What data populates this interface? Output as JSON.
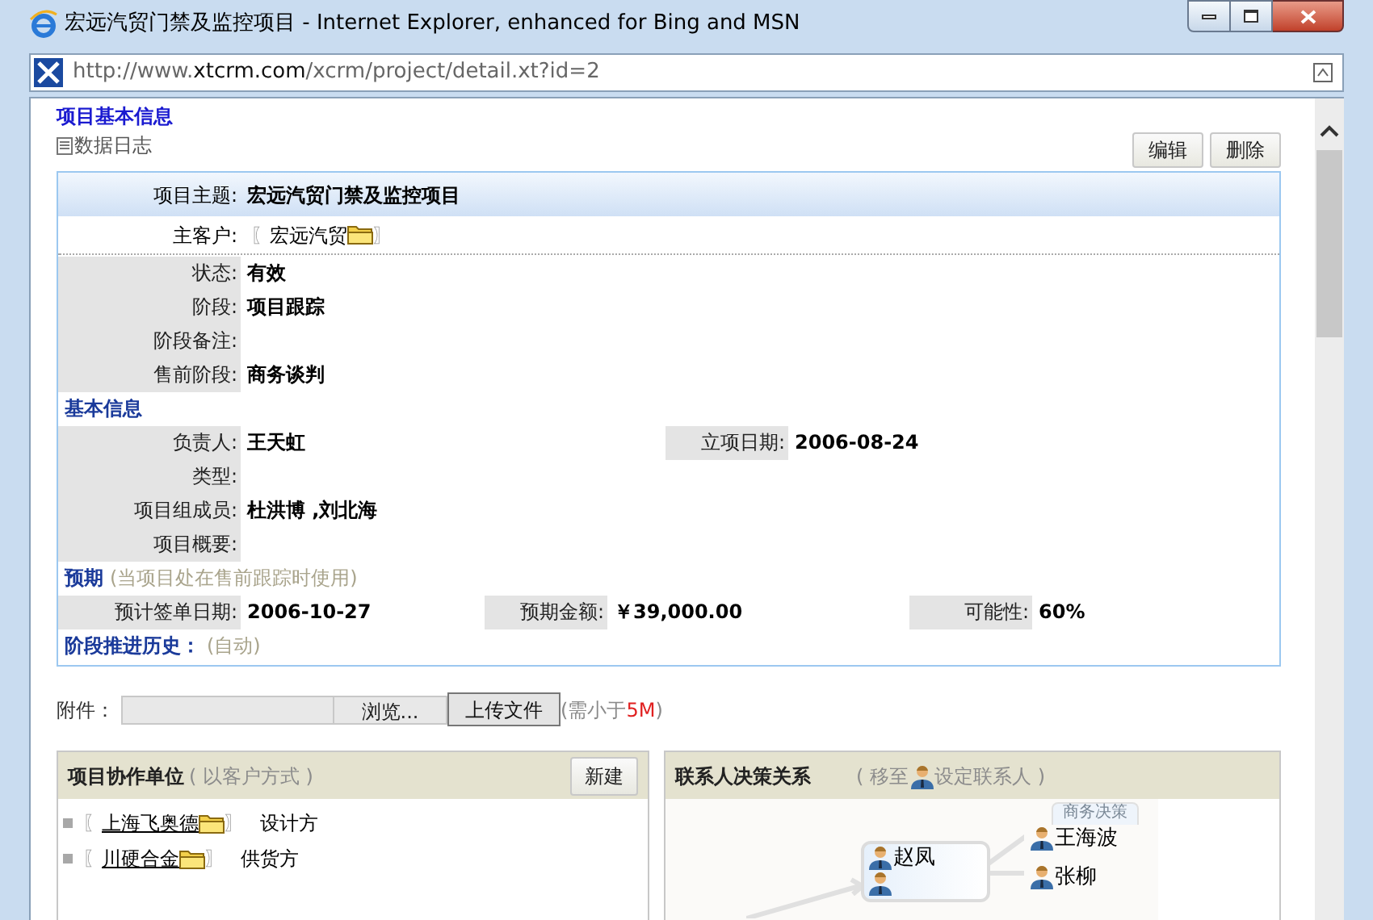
{
  "window": {
    "title": "宏远汽贸门禁及监控项目 - Internet Explorer, enhanced for Bing and MSN",
    "url": {
      "prefix": "http://www.",
      "domain": "xtcrm.com",
      "path": "/xcrm/project/detail.xt?id=2"
    }
  },
  "page": {
    "title": "项目基本信息",
    "log_link": "数据日志",
    "buttons": [
      "编辑",
      "删除"
    ]
  },
  "info": {
    "subject": {
      "label": "项目主题:",
      "value": "宏远汽贸门禁及监控项目"
    },
    "customer": {
      "label": "主客户:",
      "open": "〖",
      "value": "宏远汽贸",
      "close": "〗"
    },
    "items": [
      {
        "kind": "row",
        "fields": [
          {
            "label": "状态:",
            "value": "有效"
          }
        ]
      },
      {
        "kind": "row",
        "fields": [
          {
            "label": "阶段:",
            "value": "项目跟踪"
          }
        ]
      },
      {
        "kind": "row",
        "fields": [
          {
            "label": "阶段备注:"
          }
        ]
      },
      {
        "kind": "row",
        "fields": [
          {
            "label": "售前阶段:",
            "value": "商务谈判"
          }
        ]
      },
      {
        "kind": "heading",
        "title": "基本信息"
      },
      {
        "kind": "row",
        "fields": [
          {
            "label": "负责人:",
            "value": "王天虹"
          },
          {
            "label": "立项日期:",
            "value": "2006-08-24"
          }
        ]
      },
      {
        "kind": "row",
        "fields": [
          {
            "label": "类型:"
          }
        ]
      },
      {
        "kind": "row",
        "fields": [
          {
            "label": "项目组成员:",
            "value": "杜洪博 ,刘北海"
          }
        ]
      },
      {
        "kind": "row",
        "fields": [
          {
            "label": "项目概要:"
          }
        ]
      },
      {
        "kind": "heading",
        "title": "预期",
        "note": "(当项目处在售前跟踪时使用)"
      },
      {
        "kind": "row",
        "fields": [
          {
            "label": "预计签单日期:",
            "value": "2006-10-27"
          },
          {
            "label": "预期金额:",
            "value": "￥39,000.00"
          },
          {
            "label": "可能性:",
            "value": "60%"
          }
        ]
      },
      {
        "kind": "heading",
        "title": "阶段推进历史：",
        "note": "(自动)"
      }
    ]
  },
  "attachment": {
    "label": "附件：",
    "browse": "浏览...",
    "upload": "上传文件",
    "note_before": "(需小于",
    "note_limit": "5M",
    "note_after": ")"
  },
  "partners": {
    "title": "项目协作单位",
    "hint": "( 以客户方式 )",
    "button": "新建",
    "items": [
      {
        "open": "〖",
        "name": "上海飞奥德",
        "close": "〗",
        "role": "设计方"
      },
      {
        "open": "〖",
        "name": "川硬合金",
        "close": "〗",
        "role": "供货方"
      }
    ]
  },
  "contacts": {
    "title": "联系人决策关系",
    "hint_before": "( 移至",
    "hint_after": "设定联系人 )",
    "center": {
      "name": "赵凤"
    },
    "branches": [
      {
        "tag": "商务决策",
        "name": "王海波"
      },
      {
        "name": "张柳"
      }
    ]
  }
}
